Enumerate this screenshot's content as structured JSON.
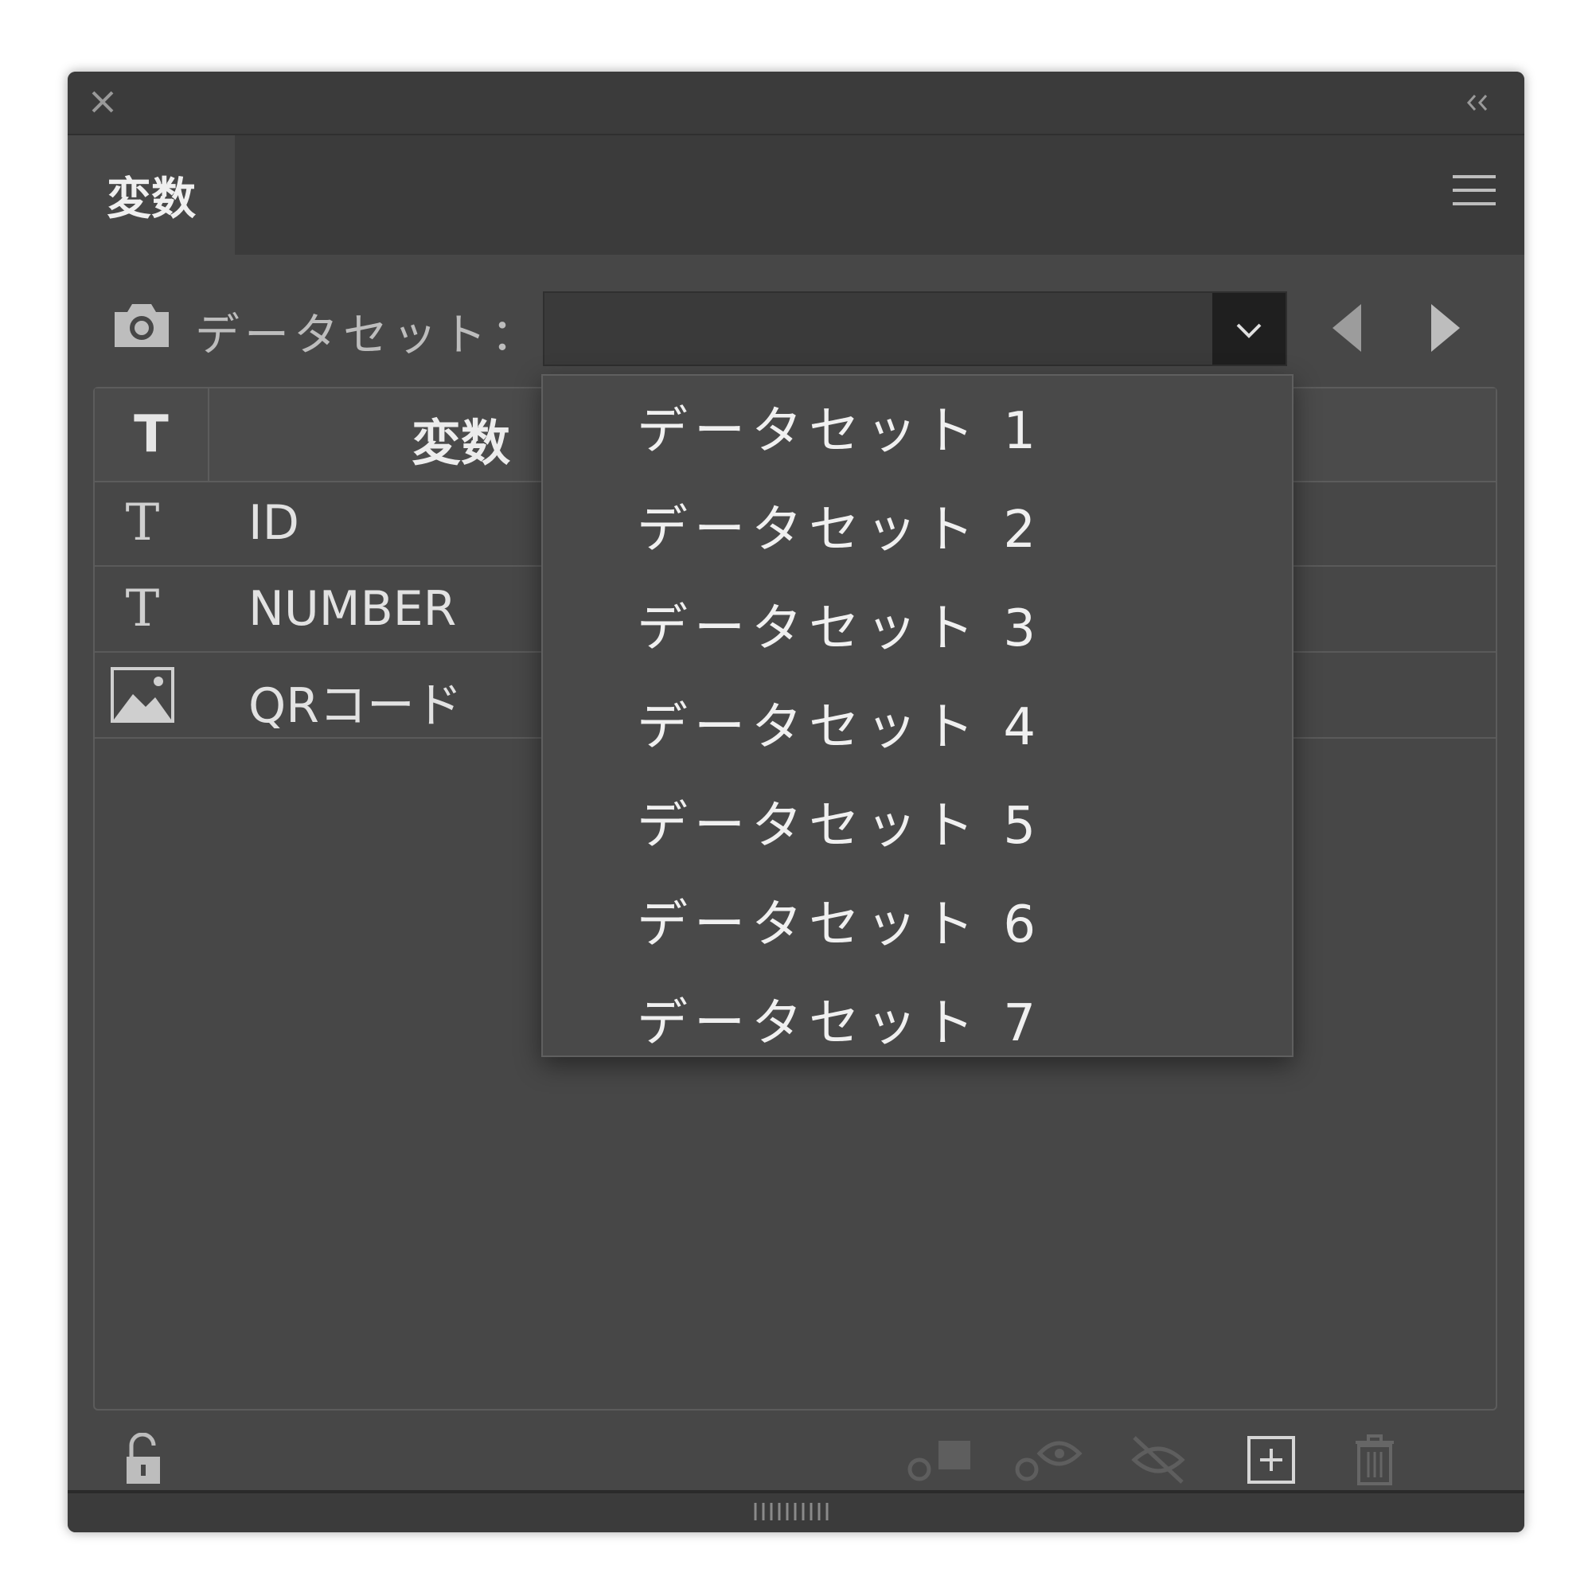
{
  "panel": {
    "tab_label": "変数",
    "dataset_label": "データセット：",
    "dataset_selected": ""
  },
  "table": {
    "header": {
      "type_label": "T",
      "name_label": "変数"
    },
    "rows": [
      {
        "type": "text",
        "type_glyph": "T",
        "name": "ID"
      },
      {
        "type": "text",
        "type_glyph": "T",
        "name": "NUMBER"
      },
      {
        "type": "image",
        "type_glyph": "",
        "name": "QRコード"
      }
    ]
  },
  "dropdown": {
    "options": [
      "データセット 1",
      "データセット 2",
      "データセット 3",
      "データセット 4",
      "データセット 5",
      "データセット 6",
      "データセット 7"
    ]
  },
  "icons": {
    "close": "close-icon",
    "collapse": "double-chevron-left-icon",
    "menu": "hamburger-menu-icon",
    "capture": "camera-icon",
    "prev": "triangle-left-icon",
    "next": "triangle-right-icon",
    "lock": "unlock-icon",
    "dynamic": "make-dynamic-icon",
    "visibility": "make-visibility-dynamic-icon",
    "unbind": "unbind-variable-icon",
    "new": "new-variable-icon",
    "delete": "trash-icon"
  },
  "colors": {
    "panel_bg": "#474747",
    "titlebar_bg": "#3b3b3b",
    "text": "#e2e2e2"
  }
}
